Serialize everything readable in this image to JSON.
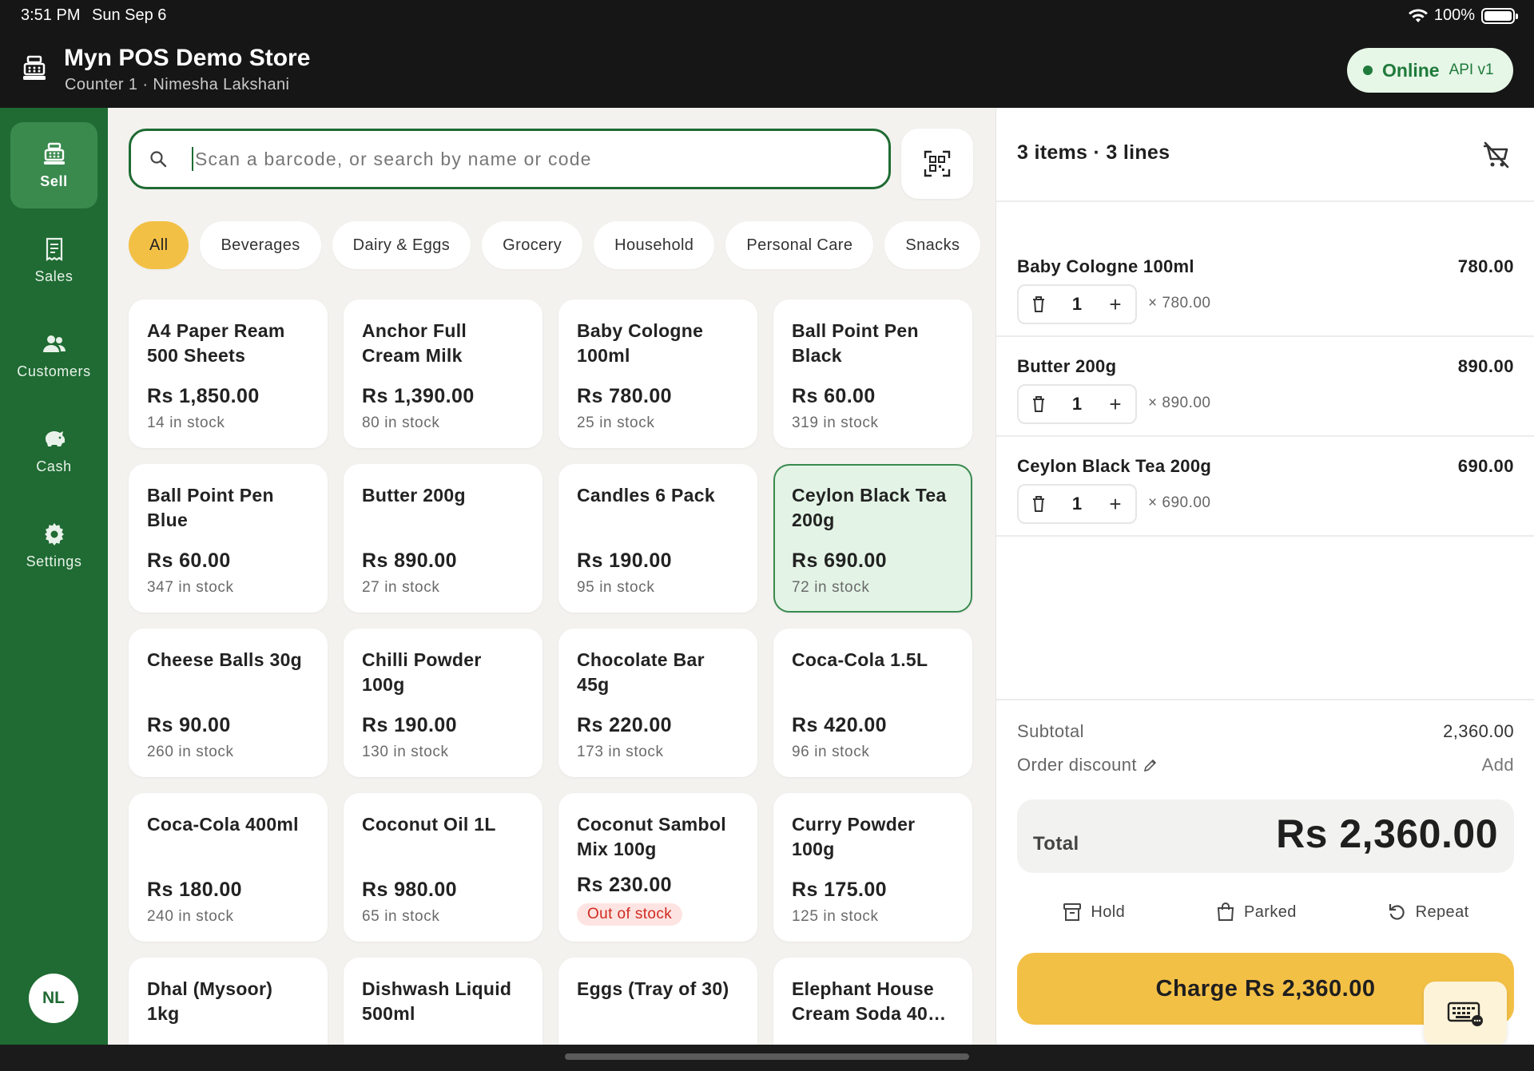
{
  "status_bar": {
    "time": "3:51 PM",
    "date": "Sun Sep 6",
    "battery": "100%"
  },
  "header": {
    "title": "Myn POS Demo Store",
    "subtitle": "Counter 1 · Nimesha Lakshani",
    "status": "Online",
    "api": "API v1"
  },
  "sidebar": {
    "items": [
      {
        "label": "Sell",
        "icon": "register-icon",
        "active": true
      },
      {
        "label": "Sales",
        "icon": "receipt-icon"
      },
      {
        "label": "Customers",
        "icon": "people-icon"
      },
      {
        "label": "Cash",
        "icon": "piggy-bank-icon"
      },
      {
        "label": "Settings",
        "icon": "gear-icon"
      }
    ],
    "avatar": "NL"
  },
  "search": {
    "placeholder": "Scan a barcode, or search by name or code",
    "value": ""
  },
  "categories": [
    "All",
    "Beverages",
    "Dairy & Eggs",
    "Grocery",
    "Household",
    "Personal Care",
    "Snacks"
  ],
  "active_category": "All",
  "products": [
    {
      "name": "A4 Paper Ream 500 Sheets",
      "price": "Rs 1,850.00",
      "stock": "14 in stock"
    },
    {
      "name": "Anchor Full Cream Milk Pow…",
      "price": "Rs 1,390.00",
      "stock": "80 in stock"
    },
    {
      "name": "Baby Cologne 100ml",
      "price": "Rs 780.00",
      "stock": "25 in stock"
    },
    {
      "name": "Ball Point Pen Black",
      "price": "Rs 60.00",
      "stock": "319 in stock"
    },
    {
      "name": "Ball Point Pen Blue",
      "price": "Rs 60.00",
      "stock": "347 in stock"
    },
    {
      "name": "Butter 200g",
      "price": "Rs 890.00",
      "stock": "27 in stock"
    },
    {
      "name": "Candles 6 Pack",
      "price": "Rs 190.00",
      "stock": "95 in stock"
    },
    {
      "name": "Ceylon Black Tea 200g",
      "price": "Rs 690.00",
      "stock": "72 in stock",
      "selected": true
    },
    {
      "name": "Cheese Balls 30g",
      "price": "Rs 90.00",
      "stock": "260 in stock"
    },
    {
      "name": "Chilli Powder 100g",
      "price": "Rs 190.00",
      "stock": "130 in stock"
    },
    {
      "name": "Chocolate Bar 45g",
      "price": "Rs 220.00",
      "stock": "173 in stock"
    },
    {
      "name": "Coca-Cola 1.5L",
      "price": "Rs 420.00",
      "stock": "96 in stock"
    },
    {
      "name": "Coca-Cola 400ml",
      "price": "Rs 180.00",
      "stock": "240 in stock"
    },
    {
      "name": "Coconut Oil 1L",
      "price": "Rs 980.00",
      "stock": "65 in stock"
    },
    {
      "name": "Coconut Sambol Mix 100g",
      "price": "Rs 230.00",
      "badge": "Out of stock"
    },
    {
      "name": "Curry Powder 100g",
      "price": "Rs 175.00",
      "stock": "125 in stock"
    },
    {
      "name": "Dhal (Mysoor) 1kg",
      "price": "",
      "stock": ""
    },
    {
      "name": "Dishwash Liquid 500ml",
      "price": "",
      "stock": ""
    },
    {
      "name": "Eggs (Tray of 30)",
      "price": "",
      "stock": ""
    },
    {
      "name": "Elephant House Cream Soda 40…",
      "price": "",
      "stock": ""
    }
  ],
  "cart": {
    "summary": "3 items · 3 lines",
    "lines": [
      {
        "name": "Baby Cologne 100ml",
        "total": "780.00",
        "qty": "1",
        "unit": "× 780.00"
      },
      {
        "name": "Butter 200g",
        "total": "890.00",
        "qty": "1",
        "unit": "× 890.00"
      },
      {
        "name": "Ceylon Black Tea 200g",
        "total": "690.00",
        "qty": "1",
        "unit": "× 690.00"
      }
    ],
    "subtotal_label": "Subtotal",
    "subtotal": "2,360.00",
    "discount_label": "Order discount",
    "discount_action": "Add",
    "total_label": "Total",
    "total": "Rs 2,360.00",
    "actions": {
      "hold": "Hold",
      "parked": "Parked",
      "repeat": "Repeat"
    },
    "charge": "Charge Rs 2,360.00"
  },
  "colors": {
    "brand_green": "#1f6b33",
    "accent_yellow": "#f3c046",
    "header_bg": "#161616",
    "out_of_stock": "#cf2a20"
  }
}
